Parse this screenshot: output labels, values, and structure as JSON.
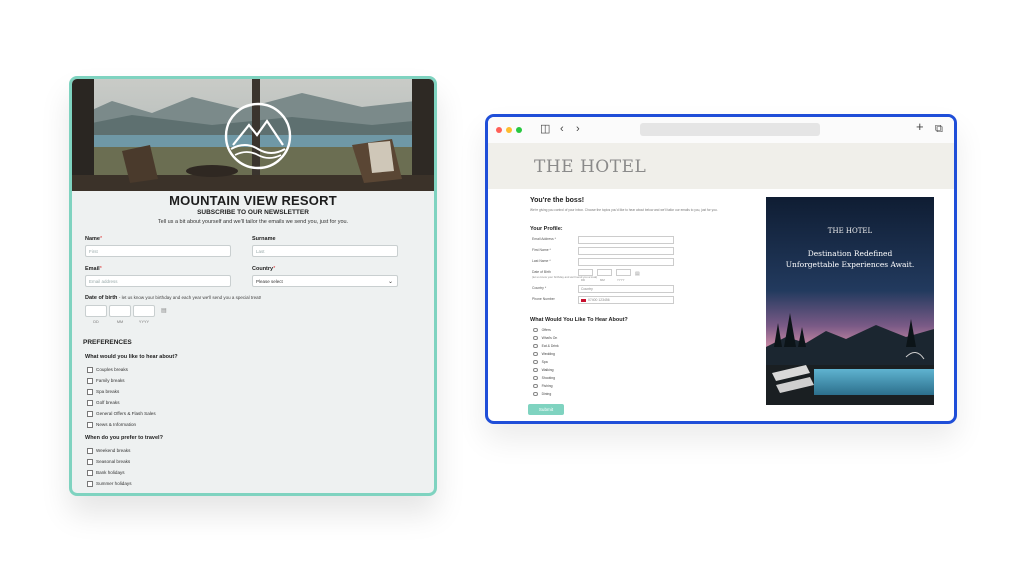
{
  "left_form": {
    "title": "MOUNTAIN VIEW RESORT",
    "subtitle": "SUBSCRIBE TO OUR NEWSLETTER",
    "intro": "Tell us a bit about yourself and we'll tailor the emails we send you, just for you.",
    "name": {
      "label": "Name",
      "required": "*",
      "placeholder": "First"
    },
    "surname": {
      "label": "Surname",
      "placeholder": "Last"
    },
    "email": {
      "label": "Email",
      "required": "*",
      "placeholder": "Email address"
    },
    "country": {
      "label": "Country",
      "required": "*",
      "selected": "Please select"
    },
    "dob": {
      "label": "Date of birth",
      "note": "- let us know your birthday and each year we'll send you a special treat!",
      "captions": [
        "DD",
        "MM",
        "YYYY"
      ]
    },
    "preferences_heading": "PREFERENCES",
    "q1": {
      "label": "What would you like to hear about?",
      "options": [
        "Couples breaks",
        "Family breaks",
        "Spa breaks",
        "Golf breaks",
        "General Offers & Flash Sales",
        "News & Information"
      ]
    },
    "q2": {
      "label": "When do you prefer to travel?",
      "options": [
        "Weekend breaks",
        "Seasonal breaks",
        "Bank holidays",
        "Summer holidays"
      ]
    }
  },
  "right_page": {
    "brand": "THE HOTEL",
    "heading": "You're the boss!",
    "subheading": "We're giving you control of your inbox. Choose the topics you'd like to hear about below and we'll tailor our emails to you, just for you.",
    "profile_heading": "Your Profile:",
    "fields": [
      {
        "label": "Email Address *"
      },
      {
        "label": "First Name *"
      },
      {
        "label": "Last Name *"
      }
    ],
    "dob_label": "Date of Birth",
    "dob_note": "(let us know your birthday and we'll send you a treat)",
    "dob_captions": [
      "DD",
      "MM",
      "YYYY"
    ],
    "country": {
      "label": "Country *",
      "value": "Country"
    },
    "phone": {
      "label": "Phone Number",
      "placeholder": "07400 123456"
    },
    "interests_heading": "What Would You Like To Hear About?",
    "interests": [
      "Offers",
      "What's On",
      "Eat & Drink",
      "Wedding",
      "Spa",
      "Walking",
      "Shooting",
      "Fishing",
      "Dining"
    ],
    "submit": "Submit",
    "ad": {
      "brand": "THE HOTEL",
      "line1": "Destination Redefined",
      "line2": "Unforgettable Experiences Await."
    }
  },
  "colors": {
    "teal_border": "#7fd3c0",
    "blue_border": "#1f4ed8",
    "submit": "#7fd3c0"
  },
  "icons": [
    "mountain-logo-icon",
    "sidebar-icon",
    "back-icon",
    "forward-icon",
    "new-tab-icon",
    "tabs-icon",
    "calendar-icon",
    "chevron-down-icon"
  ]
}
